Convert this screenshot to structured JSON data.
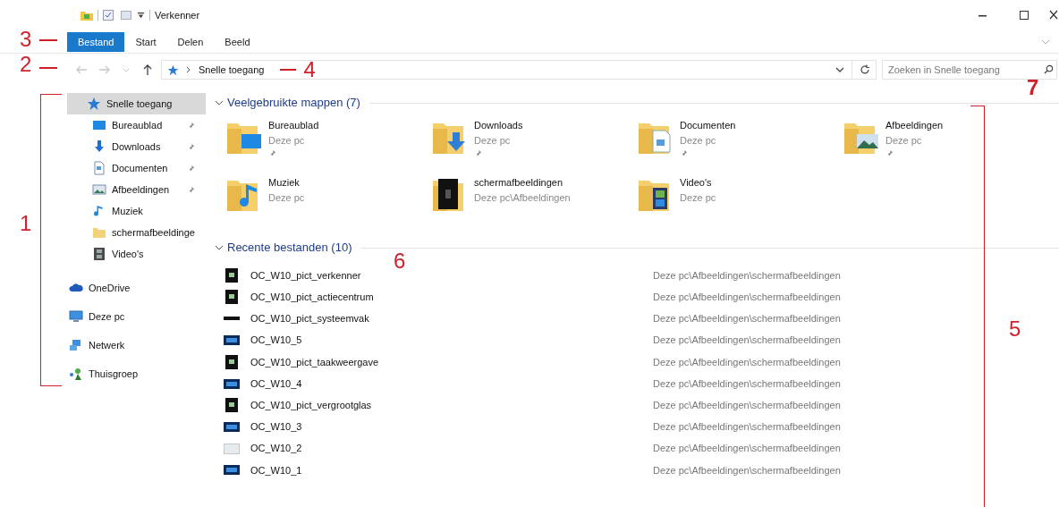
{
  "window": {
    "title": "Verkenner"
  },
  "ribbon_tabs": [
    {
      "label": "Bestand",
      "selected": true
    },
    {
      "label": "Start",
      "selected": false
    },
    {
      "label": "Delen",
      "selected": false
    },
    {
      "label": "Beeld",
      "selected": false
    }
  ],
  "nav_buttons": [
    {
      "kind": "back",
      "disabled": true
    },
    {
      "kind": "forward",
      "disabled": true
    },
    {
      "kind": "recent",
      "disabled": true
    },
    {
      "kind": "up",
      "disabled": false
    }
  ],
  "address": {
    "path": "Snelle toegang"
  },
  "search": {
    "placeholder": "Zoeken in Snelle toegang"
  },
  "nav": [
    {
      "label": "Snelle toegang",
      "kind": "star",
      "selected": true,
      "children": [
        {
          "label": "Bureaublad",
          "kind": "desktop",
          "pinned": true,
          "selected": false
        },
        {
          "label": "Downloads",
          "kind": "download",
          "pinned": true,
          "selected": false
        },
        {
          "label": "Documenten",
          "kind": "document",
          "pinned": true,
          "selected": false
        },
        {
          "label": "Afbeeldingen",
          "kind": "pictures",
          "pinned": true,
          "selected": false
        },
        {
          "label": "Muziek",
          "kind": "music",
          "pinned": false,
          "selected": false
        },
        {
          "label": "schermafbeeldinge",
          "kind": "folder",
          "pinned": false,
          "selected": false
        },
        {
          "label": "Video's",
          "kind": "videos",
          "pinned": false,
          "selected": false
        }
      ]
    },
    {
      "label": "OneDrive",
      "kind": "cloud",
      "selected": false
    },
    {
      "label": "Deze pc",
      "kind": "pc",
      "selected": false
    },
    {
      "label": "Netwerk",
      "kind": "network",
      "selected": false
    },
    {
      "label": "Thuisgroep",
      "kind": "homegroup",
      "selected": false
    }
  ],
  "frequent": {
    "title": "Veelgebruikte mappen (7)",
    "expanded": true,
    "folders": [
      {
        "name": "Bureaublad",
        "location": "Deze pc",
        "kind": "desktop",
        "pinned": true
      },
      {
        "name": "Downloads",
        "location": "Deze pc",
        "kind": "download",
        "pinned": true
      },
      {
        "name": "Documenten",
        "location": "Deze pc",
        "kind": "document",
        "pinned": true
      },
      {
        "name": "Afbeeldingen",
        "location": "Deze pc",
        "kind": "pictures",
        "pinned": true
      },
      {
        "name": "Muziek",
        "location": "Deze pc",
        "kind": "music",
        "pinned": false
      },
      {
        "name": "schermafbeeldingen",
        "location": "Deze pc\\Afbeeldingen",
        "kind": "screenshots",
        "pinned": false
      },
      {
        "name": "Video's",
        "location": "Deze pc",
        "kind": "videos",
        "pinned": false
      }
    ]
  },
  "recent": {
    "title": "Recente bestanden (10)",
    "expanded": true,
    "files": [
      {
        "name": "OC_W10_pict_verkenner",
        "location": "Deze pc\\Afbeeldingen\\schermafbeeldingen",
        "kind": "dark"
      },
      {
        "name": "OC_W10_pict_actiecentrum",
        "location": "Deze pc\\Afbeeldingen\\schermafbeeldingen",
        "kind": "dark"
      },
      {
        "name": "OC_W10_pict_systeemvak",
        "location": "Deze pc\\Afbeeldingen\\schermafbeeldingen",
        "kind": "bar"
      },
      {
        "name": "OC_W10_5",
        "location": "Deze pc\\Afbeeldingen\\schermafbeeldingen",
        "kind": "blue"
      },
      {
        "name": "OC_W10_pict_taakweergave",
        "location": "Deze pc\\Afbeeldingen\\schermafbeeldingen",
        "kind": "dark"
      },
      {
        "name": "OC_W10_4",
        "location": "Deze pc\\Afbeeldingen\\schermafbeeldingen",
        "kind": "blue"
      },
      {
        "name": "OC_W10_pict_vergrootglas",
        "location": "Deze pc\\Afbeeldingen\\schermafbeeldingen",
        "kind": "dark"
      },
      {
        "name": "OC_W10_3",
        "location": "Deze pc\\Afbeeldingen\\schermafbeeldingen",
        "kind": "blue"
      },
      {
        "name": "OC_W10_2",
        "location": "Deze pc\\Afbeeldingen\\schermafbeeldingen",
        "kind": "light"
      },
      {
        "name": "OC_W10_1",
        "location": "Deze pc\\Afbeeldingen\\schermafbeeldingen",
        "kind": "blue"
      }
    ]
  },
  "annotations": [
    {
      "label": "3"
    },
    {
      "label": "2"
    },
    {
      "label": "4"
    },
    {
      "label": "7"
    },
    {
      "label": "1"
    },
    {
      "label": "6"
    },
    {
      "label": "5"
    }
  ]
}
